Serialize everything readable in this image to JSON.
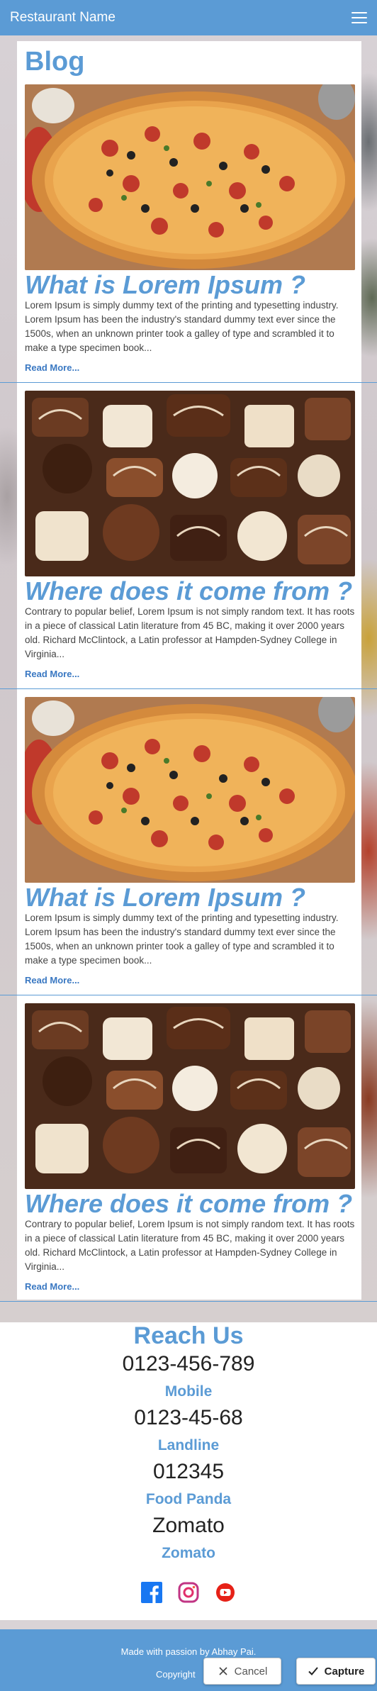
{
  "navbar": {
    "brand": "Restaurant Name"
  },
  "blog": {
    "title": "Blog",
    "read_more": "Read More...",
    "posts": [
      {
        "image": "pizza",
        "title": "What is Lorem Ipsum ?",
        "body": "Lorem Ipsum is simply dummy text of the printing and typesetting industry. Lorem Ipsum has been the industry's standard dummy text ever since the 1500s, when an unknown printer took a galley of type and scrambled it to make a type specimen book..."
      },
      {
        "image": "chocolates",
        "title": "Where does it come from ?",
        "body": "Contrary to popular belief, Lorem Ipsum is not simply random text. It has roots in a piece of classical Latin literature from 45 BC, making it over 2000 years old. Richard McClintock, a Latin professor at Hampden-Sydney College in Virginia..."
      },
      {
        "image": "pizza",
        "title": "What is Lorem Ipsum ?",
        "body": "Lorem Ipsum is simply dummy text of the printing and typesetting industry. Lorem Ipsum has been the industry's standard dummy text ever since the 1500s, when an unknown printer took a galley of type and scrambled it to make a type specimen book..."
      },
      {
        "image": "chocolates",
        "title": "Where does it come from ?",
        "body": "Contrary to popular belief, Lorem Ipsum is not simply random text. It has roots in a piece of classical Latin literature from 45 BC, making it over 2000 years old. Richard McClintock, a Latin professor at Hampden-Sydney College in Virginia..."
      }
    ]
  },
  "reach": {
    "title": "Reach Us",
    "contacts": [
      {
        "value": "0123-456-789",
        "label": "Mobile"
      },
      {
        "value": "0123-45-68",
        "label": "Landline"
      },
      {
        "value": "012345",
        "label": "Food Panda"
      },
      {
        "value": "Zomato",
        "label": "Zomato"
      }
    ],
    "socials": [
      "facebook-icon",
      "instagram-icon",
      "youtube-icon"
    ]
  },
  "footer": {
    "made_with": "Made with passion by Abhay Pai.",
    "copyright": "Copyright"
  },
  "capture_dialog": {
    "cancel_label": "Cancel",
    "capture_label": "Capture"
  },
  "colors": {
    "accent": "#5b9bd5",
    "link": "#3a78c2",
    "text": "#444444"
  }
}
